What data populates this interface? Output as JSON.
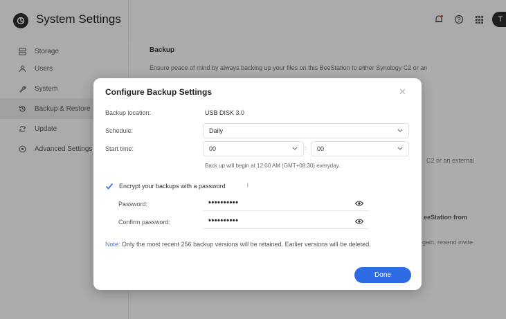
{
  "header": {
    "title": "System Settings",
    "avatar_initial": "T",
    "icons": [
      "bell-icon",
      "help-icon",
      "apps-grid-icon"
    ]
  },
  "sidebar": {
    "items": [
      {
        "label": "Storage",
        "icon": "storage-icon"
      },
      {
        "label": "Users",
        "icon": "user-icon"
      },
      {
        "label": "System",
        "icon": "wrench-icon"
      },
      {
        "label": "Backup & Restore",
        "icon": "backup-icon",
        "active": true
      },
      {
        "label": "Update",
        "icon": "refresh-icon"
      },
      {
        "label": "Advanced Settings",
        "icon": "target-icon"
      }
    ]
  },
  "main": {
    "section_title": "Backup",
    "description": "Ensure peace of mind by always backing up your files on this BeeStation to either Synology C2 or an",
    "bg_frag_1": "C2 or an external",
    "bg_frag_2": "eeStation from",
    "bg_frag_3": "gain, resend invite"
  },
  "modal": {
    "title": "Configure Backup Settings",
    "close_label": "✕",
    "backup_location_label": "Backup location:",
    "backup_location_value": "USB DISK 3.0",
    "schedule_label": "Schedule:",
    "schedule_value": "Daily",
    "start_time_label": "Start time:",
    "start_hour": "00",
    "time_separator": ":",
    "start_minute": "00",
    "schedule_hint": "Back up will begin at 12:00 AM (GMT+08:30) everyday.",
    "encrypt_label": "Encrypt your backups with a password",
    "encrypt_checked": true,
    "info_icon": "i",
    "password_label": "Password:",
    "password_value": "••••••••••",
    "confirm_label": "Confirm password:",
    "confirm_value": "••••••••••",
    "note_prefix": "Note:",
    "note_text": " Only the most recent 256 backup versions will be retained. Earlier versions will be deleted.",
    "done_label": "Done"
  },
  "colors": {
    "accent": "#2e6ce5",
    "note_accent": "#4a7fd4",
    "check": "#3b78e7"
  }
}
